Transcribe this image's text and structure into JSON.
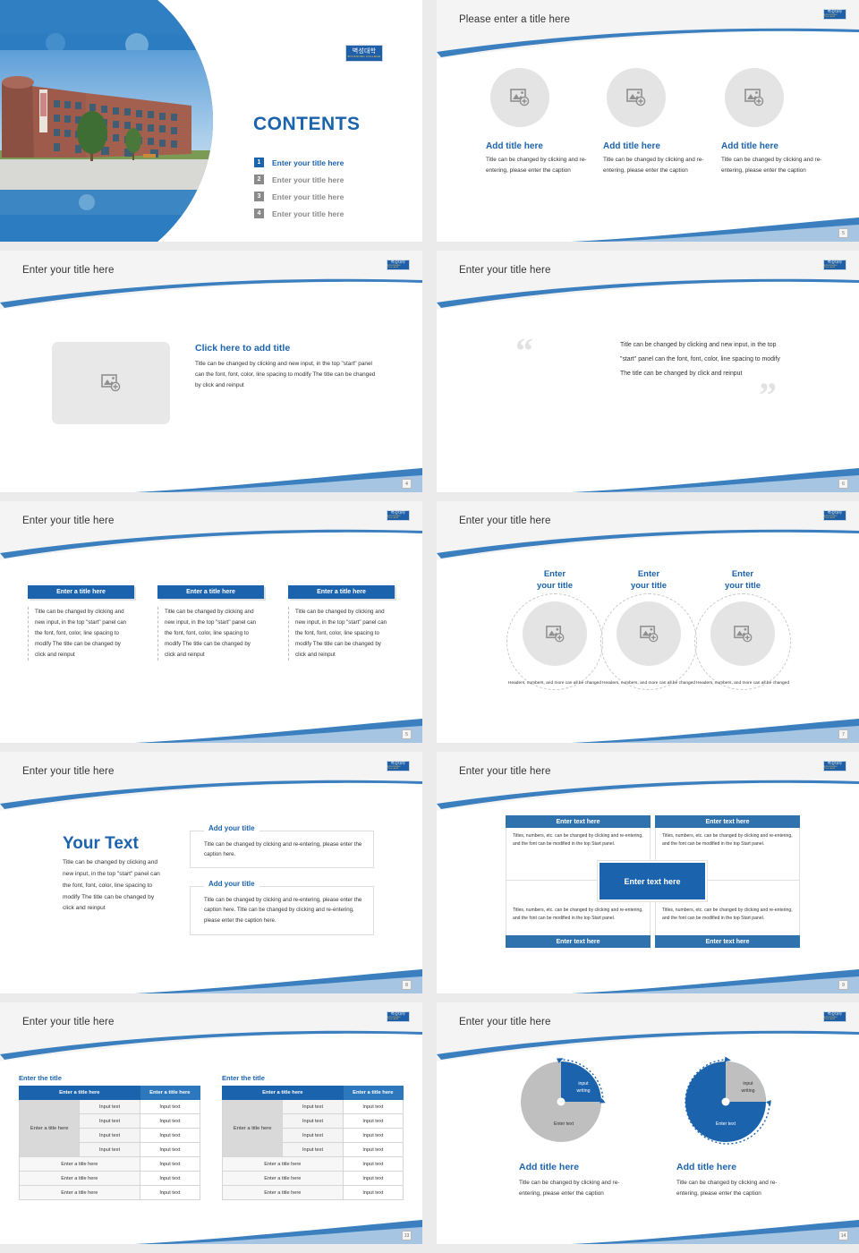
{
  "brand": {
    "logo_kr": "벽성대학",
    "logo_en": "BYUKSUNG COLLEGE",
    "accent": "#1b63ad",
    "accent_light": "#3072ad",
    "grey": "#8a8a8a"
  },
  "slides": [
    {
      "id": "cover",
      "heading": "CONTENTS",
      "toc": [
        {
          "num": "1",
          "label": "Enter your title here",
          "active": true
        },
        {
          "num": "2",
          "label": "Enter your title here",
          "active": false
        },
        {
          "num": "3",
          "label": "Enter your title here",
          "active": false
        },
        {
          "num": "4",
          "label": "Enter your title here",
          "active": false
        }
      ],
      "photo_alt": "college-building-photo"
    },
    {
      "id": "three-circles",
      "title": "Please enter a title here",
      "page": "5",
      "columns": [
        {
          "title": "Add title here",
          "body": "Title can be changed by clicking and re-entering, please enter the caption"
        },
        {
          "title": "Add title here",
          "body": "Title can be changed by clicking and re-entering, please enter the caption"
        },
        {
          "title": "Add title here",
          "body": "Title can be changed by clicking and re-entering, please enter the caption"
        }
      ]
    },
    {
      "id": "image-text",
      "title": "Enter your title here",
      "page": "4",
      "headline": "Click here to add title",
      "body": "Title can be changed by clicking and new input, in the top \"start\" panel can the font, font, color, line spacing to modify The title can be changed by click and reinput"
    },
    {
      "id": "quote",
      "title": "Enter your title here",
      "page": "6",
      "quote": "Title can be changed by clicking and new input, in the top \"start\" panel can the font, font, color, line spacing to modify The title can be changed by click and reinput",
      "open_quote": "“",
      "close_quote": "”"
    },
    {
      "id": "three-header-boxes",
      "title": "Enter your title here",
      "page": "5",
      "columns": [
        {
          "header": "Enter a title here",
          "body": "Title can be changed by clicking and new input, in the top \"start\" panel can the font, font, color, line spacing to modify The title can be changed by click and reinput"
        },
        {
          "header": "Enter a title here",
          "body": "Title can be changed by clicking and new input, in the top \"start\" panel can the font, font, color, line spacing to modify The title can be changed by click and reinput"
        },
        {
          "header": "Enter a title here",
          "body": "Title can be changed by clicking and new input, in the top \"start\" panel can the font, font, color, line spacing to modify The title can be changed by click and reinput"
        }
      ]
    },
    {
      "id": "dashed-circles",
      "title": "Enter your title here",
      "page": "7",
      "columns": [
        {
          "title": "Enter\nyour title",
          "title_l1": "Enter",
          "title_l2": "your title",
          "caption": "Headers, numbers, and more can all be changed"
        },
        {
          "title": "Enter\nyour title",
          "title_l1": "Enter",
          "title_l2": "your title",
          "caption": "Headers, numbers, and more can all be changed"
        },
        {
          "title": "Enter\nyour title",
          "title_l1": "Enter",
          "title_l2": "your title",
          "caption": "Headers, numbers, and more can all be changed"
        }
      ]
    },
    {
      "id": "your-text",
      "title": "Enter your title here",
      "page": "8",
      "headline": "Your Text",
      "body": "Title can be changed by clicking and new input, in the top \"start\" panel can the font, font, color, line spacing to modify The title can be changed by click and reinput",
      "cards": [
        {
          "title": "Add your title",
          "body": "Title can be changed by clicking and re-entering, please enter the caption here."
        },
        {
          "title": "Add your title",
          "body": "Title can be changed by clicking and re-entering, please enter the caption here. Title can be changed by clicking and re-entering, please enter the caption here."
        }
      ]
    },
    {
      "id": "quad-matrix",
      "title": "Enter your title here",
      "page": "9",
      "center": "Enter text here",
      "cells": [
        {
          "header": "Enter text here",
          "body": "Titles, numbers, etc. can be changed by clicking and re-entering, and the font can be modified in the top Start panel."
        },
        {
          "header": "Enter text here",
          "body": "Titles, numbers, etc. can be changed by clicking and re-entering, and the font can be modified in the top Start panel."
        },
        {
          "header": "Enter text here",
          "body": "Titles, numbers, etc. can be changed by clicking and re-entering, and the font can be modified in the top Start panel."
        },
        {
          "header": "Enter text here",
          "body": "Titles, numbers, etc. can be changed by clicking and re-entering, and the font can be modified in the top Start panel."
        }
      ]
    },
    {
      "id": "tables",
      "title": "Enter your title here",
      "page": "13",
      "tables": [
        {
          "caption": "Enter the title",
          "headers": [
            "Enter a title here",
            "Enter a title here"
          ],
          "side_label": "Enter a title here",
          "grouped_rows": [
            [
              "Input text",
              "Input text"
            ],
            [
              "Input text",
              "Input text"
            ],
            [
              "Input text",
              "Input text"
            ],
            [
              "Input text",
              "Input text"
            ]
          ],
          "footer_rows": [
            [
              "Enter a title here",
              "Input text"
            ],
            [
              "Enter a title here",
              "Input text"
            ],
            [
              "Enter a title here",
              "Input text"
            ]
          ]
        },
        {
          "caption": "Enter the title",
          "headers": [
            "Enter a title here",
            "Enter a title here"
          ],
          "side_label": "Enter a title here",
          "grouped_rows": [
            [
              "Input text",
              "Input text"
            ],
            [
              "Input text",
              "Input text"
            ],
            [
              "Input text",
              "Input text"
            ],
            [
              "Input text",
              "Input text"
            ]
          ],
          "footer_rows": [
            [
              "Enter a title here",
              "Input text"
            ],
            [
              "Enter a title here",
              "Input text"
            ],
            [
              "Enter a title here",
              "Input text"
            ]
          ]
        }
      ]
    },
    {
      "id": "pies",
      "title": "Enter your title here",
      "page": "14",
      "charts": [
        {
          "slice_label": "input\nwriting",
          "slice_l1": "input",
          "slice_l2": "writing",
          "rest_label": "Enter text",
          "title": "Add title here",
          "body": "Title can be changed by clicking and re-entering, please enter the caption"
        },
        {
          "slice_label": "input\nwriting",
          "slice_l1": "input",
          "slice_l2": "writing",
          "rest_label": "Enter text",
          "title": "Add title here",
          "body": "Title can be changed by clicking and re-entering, please enter the caption"
        }
      ]
    }
  ],
  "chart_data": [
    {
      "type": "pie",
      "title": "Add title here",
      "labels": [
        "input writing",
        "Enter text"
      ],
      "values": [
        25,
        75
      ],
      "colors": [
        "#1b63ad",
        "#bfbfbf"
      ],
      "legend": "none",
      "annotations": [
        "dotted arc indicator over the 25% slice"
      ]
    },
    {
      "type": "pie",
      "title": "Add title here",
      "labels": [
        "input writing",
        "Enter text"
      ],
      "values": [
        25,
        75
      ],
      "colors": [
        "#bfbfbf",
        "#1b63ad"
      ],
      "legend": "none",
      "annotations": [
        "dotted arc indicator over the 75% slice"
      ]
    }
  ]
}
